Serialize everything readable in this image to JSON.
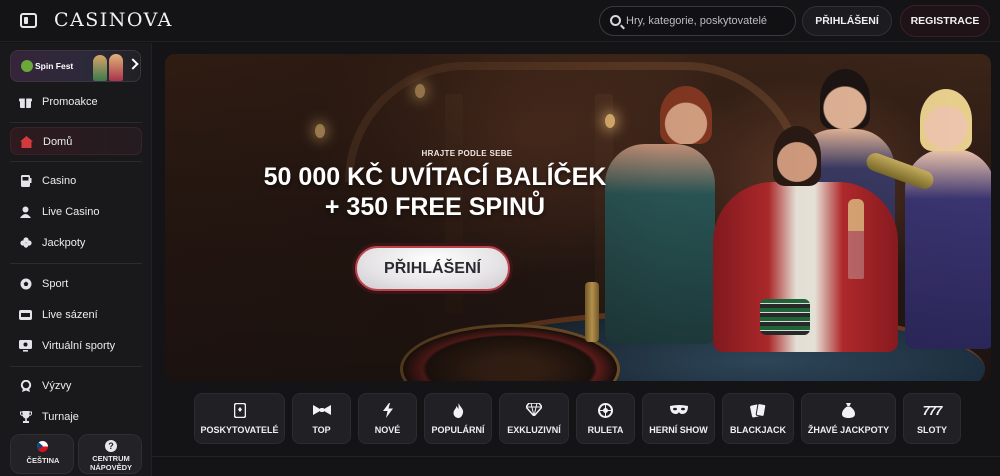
{
  "header": {
    "logo": "CASINOVA",
    "search_placeholder": "Hry, kategorie, poskytovatelé",
    "login_label": "PŘIHLÁŠENÍ",
    "register_label": "REGISTRACE"
  },
  "sidebar": {
    "promo_label": "Spin Fest",
    "items": [
      {
        "label": "Promoakce",
        "icon": "gift-icon"
      },
      {
        "label": "Domů",
        "icon": "home-icon"
      },
      {
        "label": "Casino",
        "icon": "slot-machine-icon"
      },
      {
        "label": "Live Casino",
        "icon": "dealer-icon"
      },
      {
        "label": "Jackpoty",
        "icon": "clover-icon"
      },
      {
        "label": "Sport",
        "icon": "soccer-ball-icon"
      },
      {
        "label": "Live sázení",
        "icon": "live-badge-icon"
      },
      {
        "label": "Virtuální sporty",
        "icon": "monitor-icon"
      },
      {
        "label": "Výzvy",
        "icon": "medal-icon"
      },
      {
        "label": "Turnaje",
        "icon": "trophy-icon"
      }
    ],
    "language_label": "ČEŠTINA",
    "help_label_line1": "CENTRUM",
    "help_label_line2": "NÁPOVĚDY"
  },
  "hero": {
    "kicker": "HRAJTE PODLE SEBE",
    "title_line1": "50 000 KČ UVÍTACÍ BALÍČEK",
    "title_line2": "+ 350 FREE SPINŮ",
    "cta_label": "PŘIHLÁŠENÍ"
  },
  "categories": [
    {
      "label": "POSKYTOVATELÉ",
      "icon": "provider-card-icon"
    },
    {
      "label": "TOP",
      "icon": "bow-tie-icon"
    },
    {
      "label": "NOVÉ",
      "icon": "lightning-icon"
    },
    {
      "label": "POPULÁRNÍ",
      "icon": "flame-icon"
    },
    {
      "label": "EXKLUZIVNÍ",
      "icon": "diamond-icon"
    },
    {
      "label": "RULETA",
      "icon": "roulette-icon"
    },
    {
      "label": "HERNÍ SHOW",
      "icon": "mask-icon"
    },
    {
      "label": "BLACKJACK",
      "icon": "cards-icon"
    },
    {
      "label": "ŽHAVÉ JACKPOTY",
      "icon": "money-bag-icon"
    },
    {
      "label": "SLOTY",
      "icon": "sevens-icon"
    }
  ],
  "colors": {
    "background": "#141416",
    "active_item": "#2e1a1f",
    "cta_border": "#b8454a"
  }
}
